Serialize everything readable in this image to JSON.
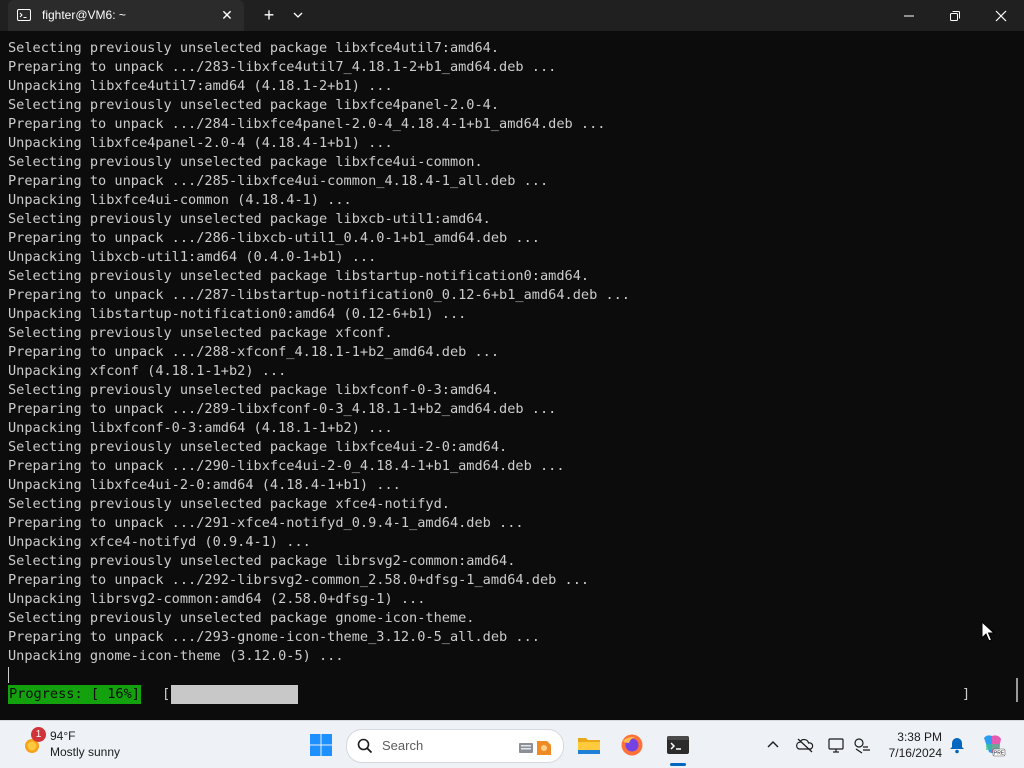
{
  "window": {
    "tab_title": "fighter@VM6: ~",
    "tab_close_glyph": "✕",
    "new_tab_glyph": "+",
    "icons": [
      "terminal-icon",
      "chevron-down-icon",
      "minimize-icon",
      "maximize-icon",
      "close-icon"
    ]
  },
  "terminal": {
    "lines": [
      "Selecting previously unselected package libxfce4util7:amd64.",
      "Preparing to unpack .../283-libxfce4util7_4.18.1-2+b1_amd64.deb ...",
      "Unpacking libxfce4util7:amd64 (4.18.1-2+b1) ...",
      "Selecting previously unselected package libxfce4panel-2.0-4.",
      "Preparing to unpack .../284-libxfce4panel-2.0-4_4.18.4-1+b1_amd64.deb ...",
      "Unpacking libxfce4panel-2.0-4 (4.18.4-1+b1) ...",
      "Selecting previously unselected package libxfce4ui-common.",
      "Preparing to unpack .../285-libxfce4ui-common_4.18.4-1_all.deb ...",
      "Unpacking libxfce4ui-common (4.18.4-1) ...",
      "Selecting previously unselected package libxcb-util1:amd64.",
      "Preparing to unpack .../286-libxcb-util1_0.4.0-1+b1_amd64.deb ...",
      "Unpacking libxcb-util1:amd64 (0.4.0-1+b1) ...",
      "Selecting previously unselected package libstartup-notification0:amd64.",
      "Preparing to unpack .../287-libstartup-notification0_0.12-6+b1_amd64.deb ...",
      "Unpacking libstartup-notification0:amd64 (0.12-6+b1) ...",
      "Selecting previously unselected package xfconf.",
      "Preparing to unpack .../288-xfconf_4.18.1-1+b2_amd64.deb ...",
      "Unpacking xfconf (4.18.1-1+b2) ...",
      "Selecting previously unselected package libxfconf-0-3:amd64.",
      "Preparing to unpack .../289-libxfconf-0-3_4.18.1-1+b2_amd64.deb ...",
      "Unpacking libxfconf-0-3:amd64 (4.18.1-1+b2) ...",
      "Selecting previously unselected package libxfce4ui-2-0:amd64.",
      "Preparing to unpack .../290-libxfce4ui-2-0_4.18.4-1+b1_amd64.deb ...",
      "Unpacking libxfce4ui-2-0:amd64 (4.18.4-1+b1) ...",
      "Selecting previously unselected package xfce4-notifyd.",
      "Preparing to unpack .../291-xfce4-notifyd_0.9.4-1_amd64.deb ...",
      "Unpacking xfce4-notifyd (0.9.4-1) ...",
      "Selecting previously unselected package librsvg2-common:amd64.",
      "Preparing to unpack .../292-librsvg2-common_2.58.0+dfsg-1_amd64.deb ...",
      "Unpacking librsvg2-common:amd64 (2.58.0+dfsg-1) ...",
      "Selecting previously unselected package gnome-icon-theme.",
      "Preparing to unpack .../293-gnome-icon-theme_3.12.0-5_all.deb ...",
      "Unpacking gnome-icon-theme (3.12.0-5) ..."
    ],
    "progress": {
      "label": "Progress: [ 16%]",
      "open_bracket": "[",
      "close_bracket": "]",
      "percent": 16
    }
  },
  "taskbar": {
    "weather": {
      "badge": "1",
      "temperature": "94°F",
      "condition": "Mostly sunny",
      "icon": "weather-sun-icon"
    },
    "start_icon": "windows-start-icon",
    "search": {
      "label": "Search",
      "icon": "search-icon"
    },
    "pinned_apps": [
      "file-explorer-icon",
      "firefox-icon",
      "terminal-icon"
    ],
    "active_app": "terminal",
    "tray_icons": [
      "chevron-up-icon",
      "onedrive-icon",
      "display-icon",
      "network-icon",
      "notification-bell-icon",
      "copilot-icon"
    ],
    "clock": {
      "time": "3:38 PM",
      "date": "7/16/2024"
    }
  },
  "colors": {
    "terminal_bg": "#0c0c0c",
    "terminal_fg": "#cccccc",
    "progress_label_bg": "#13a10e",
    "progress_fill": "#c8c8c8",
    "titlebar_bg": "#202020",
    "taskbar_bg": "#eef1f6",
    "accent": "#0067c0"
  }
}
